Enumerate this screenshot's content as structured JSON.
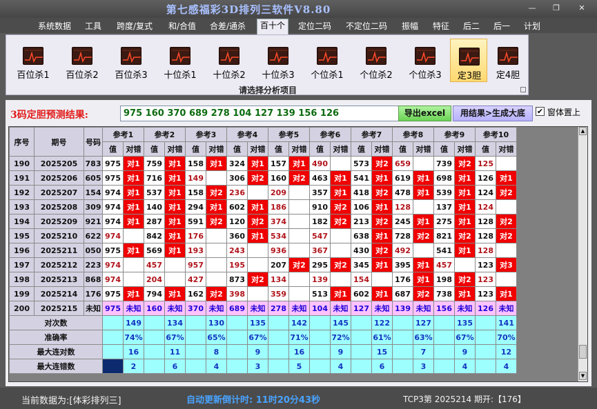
{
  "window": {
    "title": "第七感福彩3D排列三软件V8.80",
    "min_glyph": "—",
    "max_glyph": "❐",
    "close_glyph": "✕"
  },
  "menu": [
    "系统数据",
    "工具",
    "跨度/复式",
    "和/合值",
    "合差/通杀",
    "百十个",
    "定位二码",
    "不定位二码",
    "振幅",
    "特征",
    "后二",
    "后一",
    "计划"
  ],
  "ribbon": {
    "caption": "请选择分析项目",
    "buttons": [
      "百位杀1",
      "百位杀2",
      "百位杀3",
      "十位杀1",
      "十位杀2",
      "十位杀3",
      "个位杀1",
      "个位杀2",
      "个位杀3",
      "定3胆",
      "定4胆"
    ],
    "selected_index": 9
  },
  "result": {
    "label": "3码定胆预测结果:",
    "value": "975 160 370 689 278 104 127 139 156 126",
    "excel_button": "导出excel",
    "generate_button": "用结果>生成大底",
    "topmost_label": "窗体置上",
    "topmost_checked": true,
    "check_glyph": "✔"
  },
  "table": {
    "col_serial": "序号",
    "col_period": "期号",
    "col_number": "号码",
    "refs": [
      "参考1",
      "参考2",
      "参考3",
      "参考4",
      "参考5",
      "参考6",
      "参考7",
      "参考8",
      "参考9",
      "参考10"
    ],
    "sub_value": "值",
    "sub_result": "对错",
    "hit_colors": {
      "hit": "#f00000",
      "hit_text": "#ffffff",
      "miss_text": "#b0131a"
    },
    "rows": [
      {
        "seq": "190",
        "period": "2025205",
        "number": "783",
        "cells": [
          [
            "975",
            "对1"
          ],
          [
            "759",
            "对1"
          ],
          [
            "158",
            "对1"
          ],
          [
            "324",
            "对1"
          ],
          [
            "157",
            "对1"
          ],
          [
            "490",
            ""
          ],
          [
            "573",
            "对2"
          ],
          [
            "659",
            ""
          ],
          [
            "739",
            "对2"
          ],
          [
            "125",
            ""
          ]
        ]
      },
      {
        "seq": "191",
        "period": "2025206",
        "number": "605",
        "cells": [
          [
            "975",
            "对1"
          ],
          [
            "716",
            "对1"
          ],
          [
            "149",
            ""
          ],
          [
            "306",
            "对2"
          ],
          [
            "160",
            "对2"
          ],
          [
            "463",
            "对1"
          ],
          [
            "541",
            "对1"
          ],
          [
            "619",
            "对1"
          ],
          [
            "698",
            "对1"
          ],
          [
            "126",
            "对1"
          ]
        ]
      },
      {
        "seq": "192",
        "period": "2025207",
        "number": "154",
        "cells": [
          [
            "974",
            "对1"
          ],
          [
            "537",
            "对1"
          ],
          [
            "158",
            "对2"
          ],
          [
            "236",
            ""
          ],
          [
            "209",
            ""
          ],
          [
            "357",
            "对1"
          ],
          [
            "418",
            "对2"
          ],
          [
            "478",
            "对1"
          ],
          [
            "539",
            "对1"
          ],
          [
            "124",
            "对2"
          ]
        ]
      },
      {
        "seq": "193",
        "period": "2025208",
        "number": "309",
        "cells": [
          [
            "974",
            "对1"
          ],
          [
            "140",
            "对1"
          ],
          [
            "294",
            "对1"
          ],
          [
            "602",
            "对1"
          ],
          [
            "186",
            ""
          ],
          [
            "910",
            "对2"
          ],
          [
            "106",
            "对1"
          ],
          [
            "128",
            ""
          ],
          [
            "137",
            "对1"
          ],
          [
            "124",
            ""
          ]
        ]
      },
      {
        "seq": "194",
        "period": "2025209",
        "number": "921",
        "cells": [
          [
            "974",
            "对1"
          ],
          [
            "287",
            "对1"
          ],
          [
            "591",
            "对2"
          ],
          [
            "120",
            "对2"
          ],
          [
            "374",
            ""
          ],
          [
            "182",
            "对2"
          ],
          [
            "213",
            "对2"
          ],
          [
            "245",
            "对1"
          ],
          [
            "275",
            "对1"
          ],
          [
            "128",
            "对2"
          ]
        ]
      },
      {
        "seq": "195",
        "period": "2025210",
        "number": "622",
        "cells": [
          [
            "974",
            ""
          ],
          [
            "842",
            "对1"
          ],
          [
            "176",
            ""
          ],
          [
            "360",
            "对1"
          ],
          [
            "534",
            ""
          ],
          [
            "547",
            ""
          ],
          [
            "638",
            "对1"
          ],
          [
            "728",
            "对2"
          ],
          [
            "821",
            "对2"
          ],
          [
            "128",
            "对2"
          ]
        ]
      },
      {
        "seq": "196",
        "period": "2025211",
        "number": "050",
        "cells": [
          [
            "975",
            "对1"
          ],
          [
            "569",
            "对1"
          ],
          [
            "193",
            ""
          ],
          [
            "243",
            ""
          ],
          [
            "936",
            ""
          ],
          [
            "367",
            ""
          ],
          [
            "430",
            "对2"
          ],
          [
            "492",
            ""
          ],
          [
            "541",
            "对1"
          ],
          [
            "128",
            ""
          ]
        ]
      },
      {
        "seq": "197",
        "period": "2025212",
        "number": "223",
        "cells": [
          [
            "974",
            ""
          ],
          [
            "457",
            ""
          ],
          [
            "957",
            ""
          ],
          [
            "195",
            ""
          ],
          [
            "207",
            "对2"
          ],
          [
            "295",
            "对2"
          ],
          [
            "345",
            "对1"
          ],
          [
            "395",
            "对1"
          ],
          [
            "457",
            ""
          ],
          [
            "123",
            "对3"
          ]
        ]
      },
      {
        "seq": "198",
        "period": "2025213",
        "number": "868",
        "cells": [
          [
            "974",
            ""
          ],
          [
            "204",
            ""
          ],
          [
            "427",
            ""
          ],
          [
            "873",
            "对2"
          ],
          [
            "134",
            ""
          ],
          [
            "139",
            ""
          ],
          [
            "154",
            ""
          ],
          [
            "176",
            "对1"
          ],
          [
            "198",
            "对2"
          ],
          [
            "123",
            ""
          ]
        ]
      },
      {
        "seq": "199",
        "period": "2025214",
        "number": "176",
        "cells": [
          [
            "975",
            "对1"
          ],
          [
            "794",
            "对1"
          ],
          [
            "162",
            "对2"
          ],
          [
            "398",
            ""
          ],
          [
            "359",
            ""
          ],
          [
            "513",
            "对1"
          ],
          [
            "602",
            "对1"
          ],
          [
            "687",
            "对2"
          ],
          [
            "738",
            "对1"
          ],
          [
            "123",
            "对1"
          ]
        ]
      },
      {
        "seq": "200",
        "period": "2025215",
        "number": "未知",
        "cells": [
          [
            "975",
            "未知"
          ],
          [
            "160",
            "未知"
          ],
          [
            "370",
            "未知"
          ],
          [
            "689",
            "未知"
          ],
          [
            "278",
            "未知"
          ],
          [
            "104",
            "未知"
          ],
          [
            "127",
            "未知"
          ],
          [
            "139",
            "未知"
          ],
          [
            "156",
            "未知"
          ],
          [
            "126",
            "未知"
          ]
        ]
      }
    ],
    "stats": [
      {
        "label": "对次数",
        "values": [
          "149",
          "134",
          "130",
          "135",
          "142",
          "145",
          "122",
          "127",
          "135",
          "141"
        ]
      },
      {
        "label": "准确率",
        "values": [
          "74%",
          "67%",
          "65%",
          "67%",
          "71%",
          "72%",
          "61%",
          "63%",
          "67%",
          "70%"
        ]
      },
      {
        "label": "最大连对数",
        "values": [
          "16",
          "11",
          "8",
          "9",
          "16",
          "9",
          "15",
          "7",
          "9",
          "12"
        ]
      },
      {
        "label": "最大连错数",
        "values": [
          "2",
          "6",
          "4",
          "3",
          "5",
          "4",
          "6",
          "3",
          "4",
          "4"
        ]
      }
    ]
  },
  "status": {
    "current_data": "当前数据为:[体彩排列三]",
    "countdown": "自动更新倒计时: 11时20分43秒",
    "draw_info": "TCP3第 2025214 期开:【176】"
  }
}
